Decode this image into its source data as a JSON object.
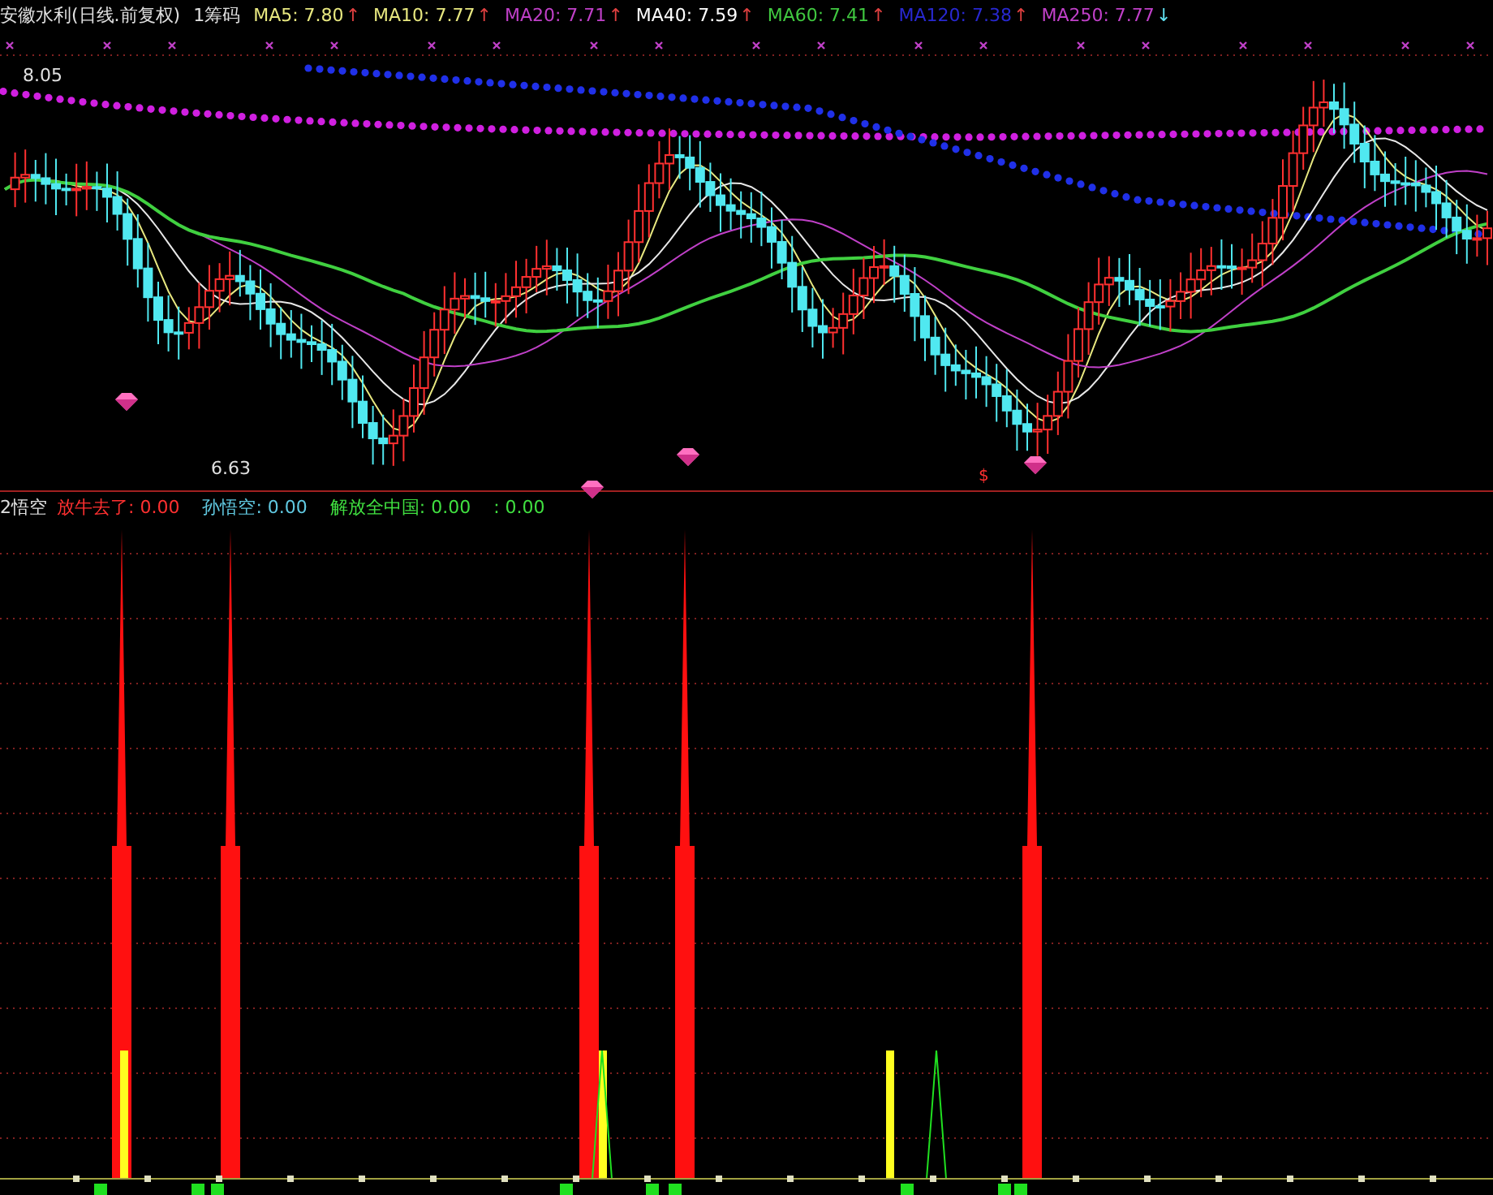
{
  "title": {
    "stock": "安徽水利(日线.前复权)",
    "mode": "1筹码"
  },
  "ma_legend": [
    {
      "label": "MA5: 7.80",
      "color": "#e8e880",
      "arrow": {
        "glyph": "↑",
        "color": "#e04040"
      }
    },
    {
      "label": "MA10: 7.77",
      "color": "#e8e880",
      "arrow": {
        "glyph": "↑",
        "color": "#e04040"
      }
    },
    {
      "label": "MA20: 7.71",
      "color": "#c040c8",
      "arrow": {
        "glyph": "↑",
        "color": "#e04040"
      }
    },
    {
      "label": "MA40: 7.59",
      "color": "#ffffff",
      "arrow": {
        "glyph": "↑",
        "color": "#e04040"
      }
    },
    {
      "label": "MA60: 7.41",
      "color": "#40c840",
      "arrow": {
        "glyph": "↑",
        "color": "#e04040"
      }
    },
    {
      "label": "MA120: 7.38",
      "color": "#2828d0",
      "arrow": {
        "glyph": "↑",
        "color": "#e04040"
      }
    },
    {
      "label": "MA250: 7.77",
      "color": "#c040c8",
      "arrow": {
        "glyph": "↓",
        "color": "#60e0f0"
      }
    }
  ],
  "price_labels": {
    "high": "8.05",
    "low": "6.63"
  },
  "signal_mark": "$",
  "indicator": {
    "name": "2悟空",
    "lines": [
      {
        "label": "放牛去了: 0.00",
        "color": "#ff3030"
      },
      {
        "label": "孙悟空: 0.00",
        "color": "#60c8e0"
      },
      {
        "label": "解放全中国: 0.00",
        "color": "#40e040"
      },
      {
        "label": ": 0.00",
        "color": "#40e040"
      }
    ]
  }
}
